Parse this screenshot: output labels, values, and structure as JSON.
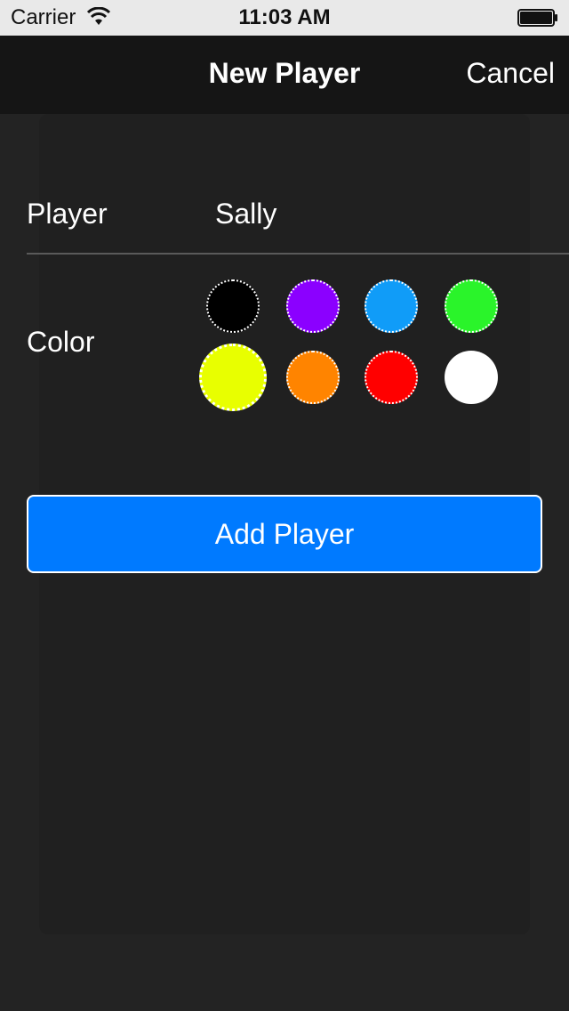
{
  "status_bar": {
    "carrier": "Carrier",
    "time": "11:03 AM"
  },
  "nav": {
    "title": "New Player",
    "cancel_label": "Cancel"
  },
  "form": {
    "player_label": "Player",
    "player_value": "Sally",
    "color_label": "Color",
    "colors": [
      {
        "name": "black",
        "hex": "#000000",
        "selected": false
      },
      {
        "name": "purple",
        "hex": "#8b00ff",
        "selected": false
      },
      {
        "name": "blue",
        "hex": "#109cf8",
        "selected": false
      },
      {
        "name": "green",
        "hex": "#2af42a",
        "selected": false
      },
      {
        "name": "yellow",
        "hex": "#e8ff00",
        "selected": true
      },
      {
        "name": "orange",
        "hex": "#ff8400",
        "selected": false
      },
      {
        "name": "red",
        "hex": "#ff0000",
        "selected": false
      },
      {
        "name": "white",
        "hex": "#ffffff",
        "selected": false
      }
    ]
  },
  "actions": {
    "add_player_label": "Add Player"
  },
  "theme": {
    "accent": "#007aff",
    "background": "#232323",
    "nav_background": "#151515"
  }
}
